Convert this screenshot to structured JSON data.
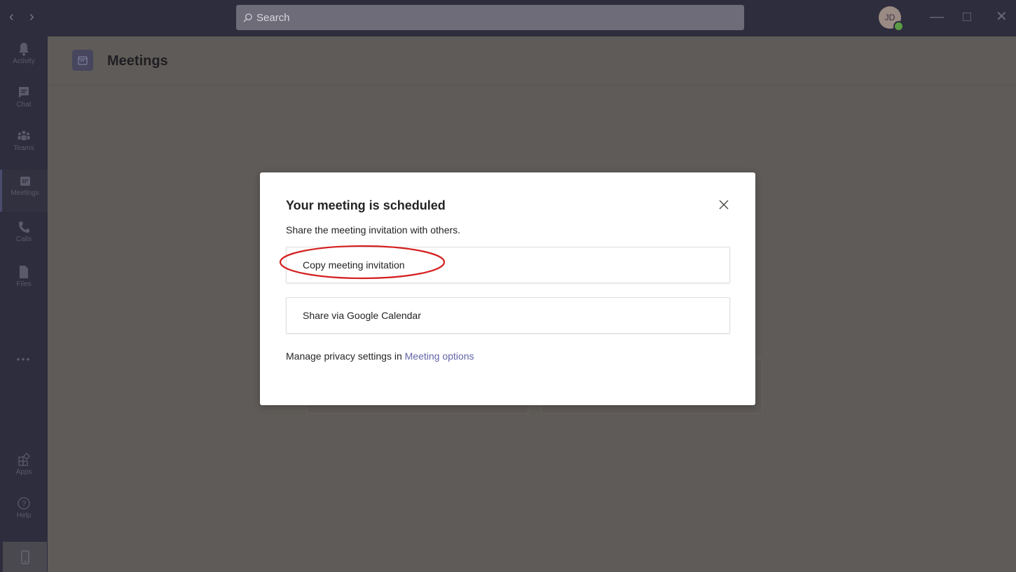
{
  "titlebar": {
    "back_icon": "chevron-left-icon",
    "forward_icon": "chevron-right-icon",
    "search_placeholder": "Search",
    "avatar_initials": "JD"
  },
  "rail": {
    "items": [
      {
        "label": "Activity",
        "icon": "bell-icon"
      },
      {
        "label": "Chat",
        "icon": "chat-icon"
      },
      {
        "label": "Teams",
        "icon": "teams-icon"
      },
      {
        "label": "Meetings",
        "icon": "calendar-icon"
      },
      {
        "label": "Calls",
        "icon": "phone-icon"
      },
      {
        "label": "Files",
        "icon": "file-icon"
      }
    ],
    "more": "•••",
    "bottom": [
      {
        "label": "Apps",
        "icon": "apps-icon"
      },
      {
        "label": "Help",
        "icon": "help-icon"
      }
    ]
  },
  "header": {
    "title": "Meetings"
  },
  "modal": {
    "title": "Your meeting is scheduled",
    "subtitle": "Share the meeting invitation with others.",
    "copy_label": "Copy meeting invitation",
    "google_label": "Share via Google Calendar",
    "privacy_text": "Manage privacy settings in ",
    "privacy_link": "Meeting options",
    "highlight_color": "#d42020"
  },
  "colors": {
    "rail_bg": "#2e2d3d",
    "overlay_bg": "#5f5b58",
    "link": "#6264a7"
  }
}
